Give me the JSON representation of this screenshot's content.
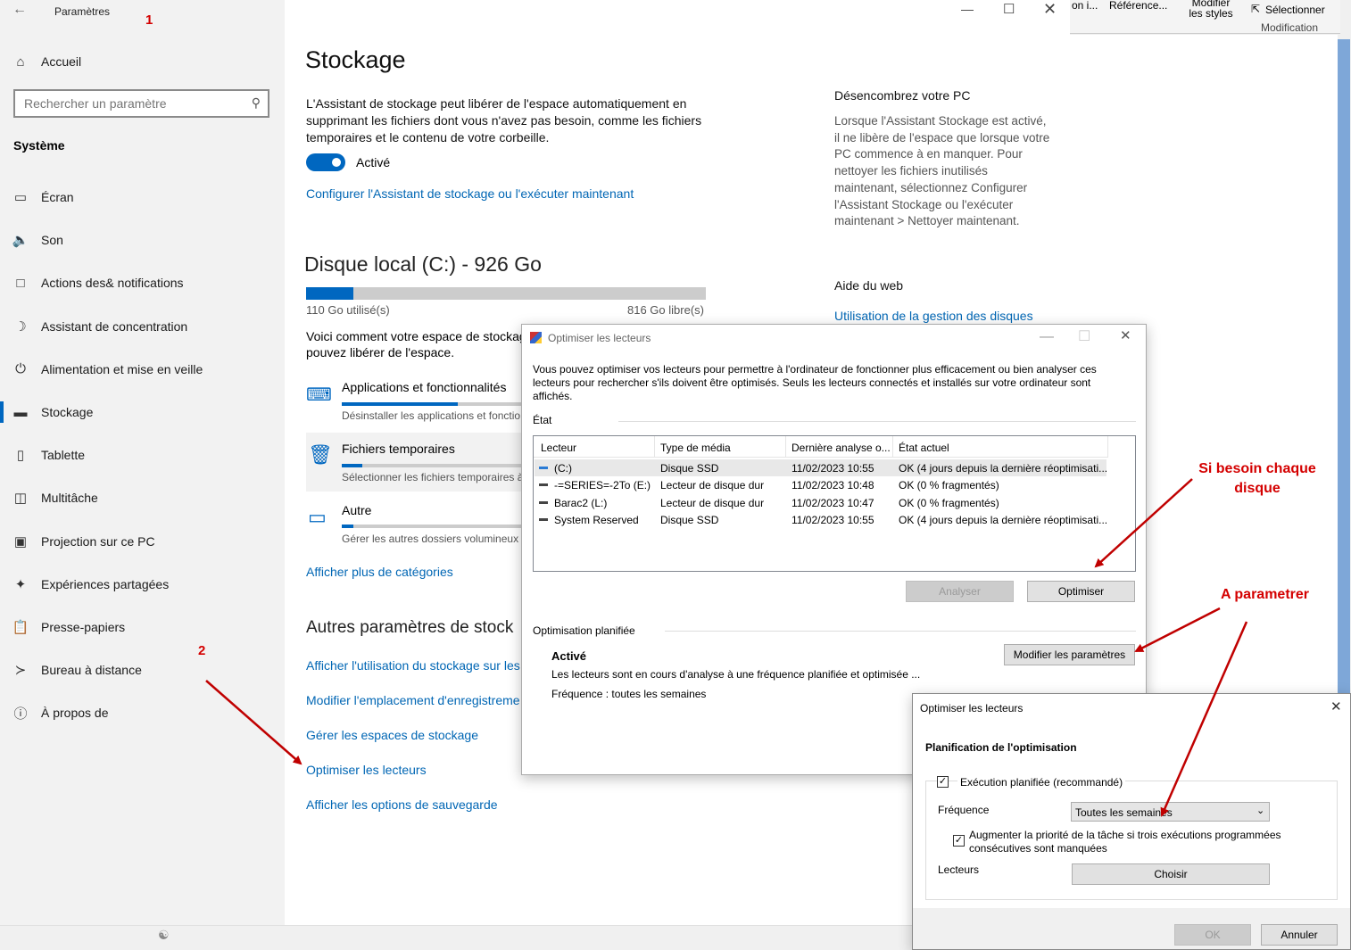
{
  "sidebar": {
    "title": "Paramètres",
    "annotation_1": "1",
    "home": "Accueil",
    "search_placeholder": "Rechercher un paramètre",
    "section": "Système",
    "items": [
      {
        "label": "Écran",
        "icon": "monitor-icon"
      },
      {
        "label": "Son",
        "icon": "speaker-icon"
      },
      {
        "label": "Actions des& notifications",
        "icon": "notification-icon"
      },
      {
        "label": "Assistant de concentration",
        "icon": "moon-icon"
      },
      {
        "label": "Alimentation et mise en veille",
        "icon": "power-icon"
      },
      {
        "label": "Stockage",
        "icon": "storage-icon"
      },
      {
        "label": "Tablette",
        "icon": "tablet-icon"
      },
      {
        "label": "Multitâche",
        "icon": "multitask-icon"
      },
      {
        "label": "Projection sur ce PC",
        "icon": "projection-icon"
      },
      {
        "label": "Expériences partagées",
        "icon": "share-icon"
      },
      {
        "label": "Presse-papiers",
        "icon": "clipboard-icon"
      },
      {
        "label": "Bureau à distance",
        "icon": "remote-icon"
      },
      {
        "label": "À propos de",
        "icon": "info-icon"
      }
    ],
    "annotation_2": "2"
  },
  "main": {
    "title": "Stockage",
    "description": "L'Assistant de stockage peut libérer de l'espace automatiquement en supprimant les fichiers dont vous n'avez pas besoin, comme les fichiers temporaires et le contenu de votre corbeille.",
    "toggle_label": "Activé",
    "toggle_on": true,
    "configure_link": "Configurer l'Assistant de stockage ou l'exécuter maintenant",
    "disk_title": "Disque local (C:) - 926 Go",
    "used": "110 Go utilisé(s)",
    "free": "816 Go libre(s)",
    "used_fraction": 0.119,
    "usage_text_1": "Voici comment votre espace de stockag",
    "usage_text_2": "pouvez libérer de l'espace.",
    "categories": [
      {
        "label": "Applications et fonctionnalités",
        "sub": "Désinstaller les applications et fonctio",
        "fraction": 0.5
      },
      {
        "label": "Fichiers temporaires",
        "sub": "Sélectionner les fichiers temporaires à",
        "fraction": 0.09
      },
      {
        "label": "Autre",
        "sub": "Gérer les autres dossiers volumineux",
        "fraction": 0.05
      }
    ],
    "more_categories": "Afficher plus de catégories",
    "other_title": "Autres paramètres de stock",
    "other_links": [
      "Afficher l'utilisation du stockage sur les",
      "Modifier l'emplacement d'enregistreme",
      "Gérer les espaces de stockage",
      "Optimiser les lecteurs",
      "Afficher les options de sauvegarde"
    ],
    "side_title": "Désencombrez votre PC",
    "side_text": "Lorsque l'Assistant Stockage est activé, il ne libère de l'espace que lorsque votre PC commence à en manquer. Pour nettoyer les fichiers inutilisés maintenant, sélectionnez Configurer l'Assistant Stockage ou l'exécuter maintenant > Nettoyer maintenant.",
    "help_title": "Aide du web",
    "help_link": "Utilisation de la gestion des disques"
  },
  "word": {
    "btn1": "on i...",
    "btn2": "Référence...",
    "btn3": "Modifier les styles",
    "btn4": "Sélectionner",
    "group": "Modification"
  },
  "optimize": {
    "title": "Optimiser les lecteurs",
    "intro": "Vous pouvez optimiser vos lecteurs pour permettre à l'ordinateur de fonctionner plus efficacement ou bien analyser ces lecteurs pour rechercher s'ils doivent être optimisés. Seuls les lecteurs connectés et installés sur votre ordinateur sont affichés.",
    "state_label": "État",
    "columns": [
      "Lecteur",
      "Type de média",
      "Dernière analyse o...",
      "État actuel"
    ],
    "rows": [
      {
        "drive": "(C:)",
        "media": "Disque SSD",
        "last": "11/02/2023 10:55",
        "status": "OK (4 jours depuis la dernière réoptimisati..."
      },
      {
        "drive": "-=SERIES=-2To (E:)",
        "media": "Lecteur de disque dur",
        "last": "11/02/2023 10:48",
        "status": "OK (0 % fragmentés)"
      },
      {
        "drive": "Barac2 (L:)",
        "media": "Lecteur de disque dur",
        "last": "11/02/2023 10:47",
        "status": "OK (0 % fragmentés)"
      },
      {
        "drive": "System Reserved",
        "media": "Disque SSD",
        "last": "11/02/2023 10:55",
        "status": "OK (4 jours depuis la dernière réoptimisati..."
      }
    ],
    "analyze": "Analyser",
    "optimize": "Optimiser",
    "scheduled_label": "Optimisation planifiée",
    "scheduled_state": "Activé",
    "scheduled_text": "Les lecteurs sont en cours d'analyse à une fréquence planifiée et optimisée ...",
    "frequency_text": "Fréquence : toutes les semaines",
    "modify": "Modifier les paramètres"
  },
  "schedule": {
    "title": "Optimiser les lecteurs",
    "heading": "Planification de l'optimisation",
    "run_label": "Exécution planifiée (recommandé)",
    "frequency_label": "Fréquence",
    "frequency_value": "Toutes les semaines",
    "priority_label": "Augmenter la priorité de la tâche si trois exécutions programmées consécutives sont manquées",
    "drives_label": "Lecteurs",
    "choose": "Choisir",
    "ok": "OK",
    "cancel": "Annuler"
  },
  "annotations": {
    "each_disk_1": "Si besoin chaque",
    "each_disk_2": "disque",
    "configure": "A parametrer"
  },
  "colors": {
    "accent": "#0067c0",
    "link": "#0066b4",
    "annotation": "#d40000"
  }
}
